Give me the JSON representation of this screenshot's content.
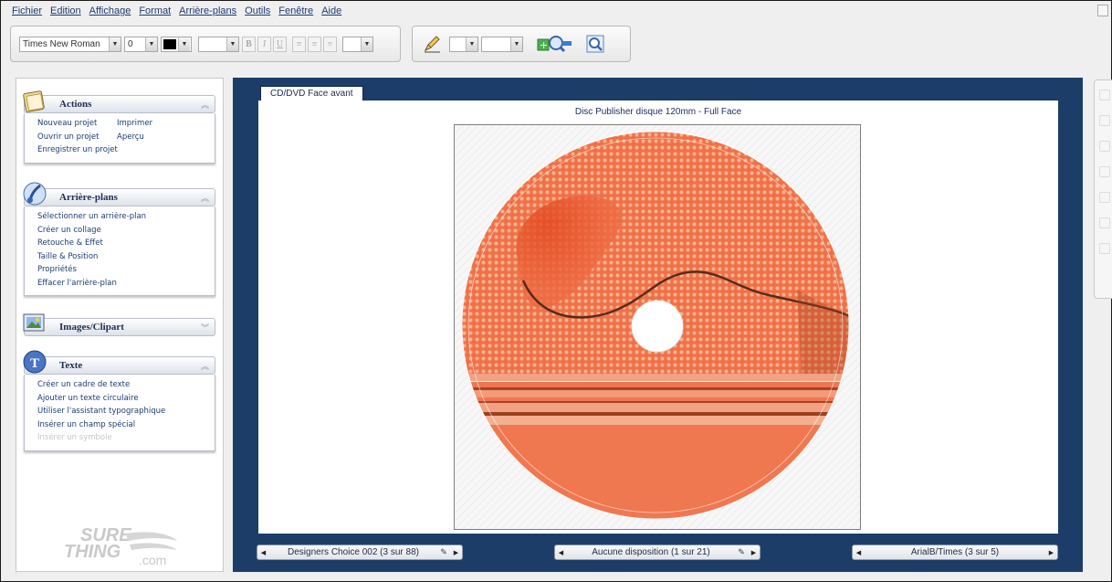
{
  "menu": [
    "Fichier",
    "Edition",
    "Affichage",
    "Format",
    "Arrière-plans",
    "Outils",
    "Fenêtre",
    "Aide"
  ],
  "toolbar": {
    "font_name": "Times New Roman",
    "font_size": "0",
    "text_color": "#000000",
    "bold_label": "B",
    "italic_label": "I",
    "underline_label": "U",
    "zoom_in_icon": "zoom-in-icon",
    "zoom_fit_icon": "zoom-fit-icon"
  },
  "panels": {
    "actions": {
      "title": "Actions",
      "left_links": [
        "Nouveau projet",
        "Ouvrir un projet",
        "Enregistrer un projet"
      ],
      "right_links": [
        "Imprimer",
        "Aperçu"
      ]
    },
    "backgrounds": {
      "title": "Arrière-plans",
      "links": [
        "Sélectionner un arrière-plan",
        "Créer un collage",
        "Retouche & Effet",
        "Taille & Position",
        "Propriétés",
        "Effacer l'arrière-plan"
      ]
    },
    "images": {
      "title": "Images/Clipart"
    },
    "text": {
      "title": "Texte",
      "links": [
        "Créer un cadre de texte",
        "Ajouter un texte circulaire",
        "Utiliser l'assistant typographique",
        "Insérer un champ spécial"
      ],
      "disabled_link": "Insérer un symbole"
    }
  },
  "logo": {
    "line1": "SURE",
    "line2": "THING",
    "line3": ".com"
  },
  "canvas": {
    "tab_label": "CD/DVD Face avant",
    "page_title": "Disc Publisher disque 120mm - Full Face",
    "disc_color": "#ef7a52"
  },
  "bottom": {
    "design": "Designers Choice 002 (3 sur 88)",
    "layout": "Aucune disposition (1 sur 21)",
    "fonts": "ArialB/Times (3 sur 5)"
  }
}
